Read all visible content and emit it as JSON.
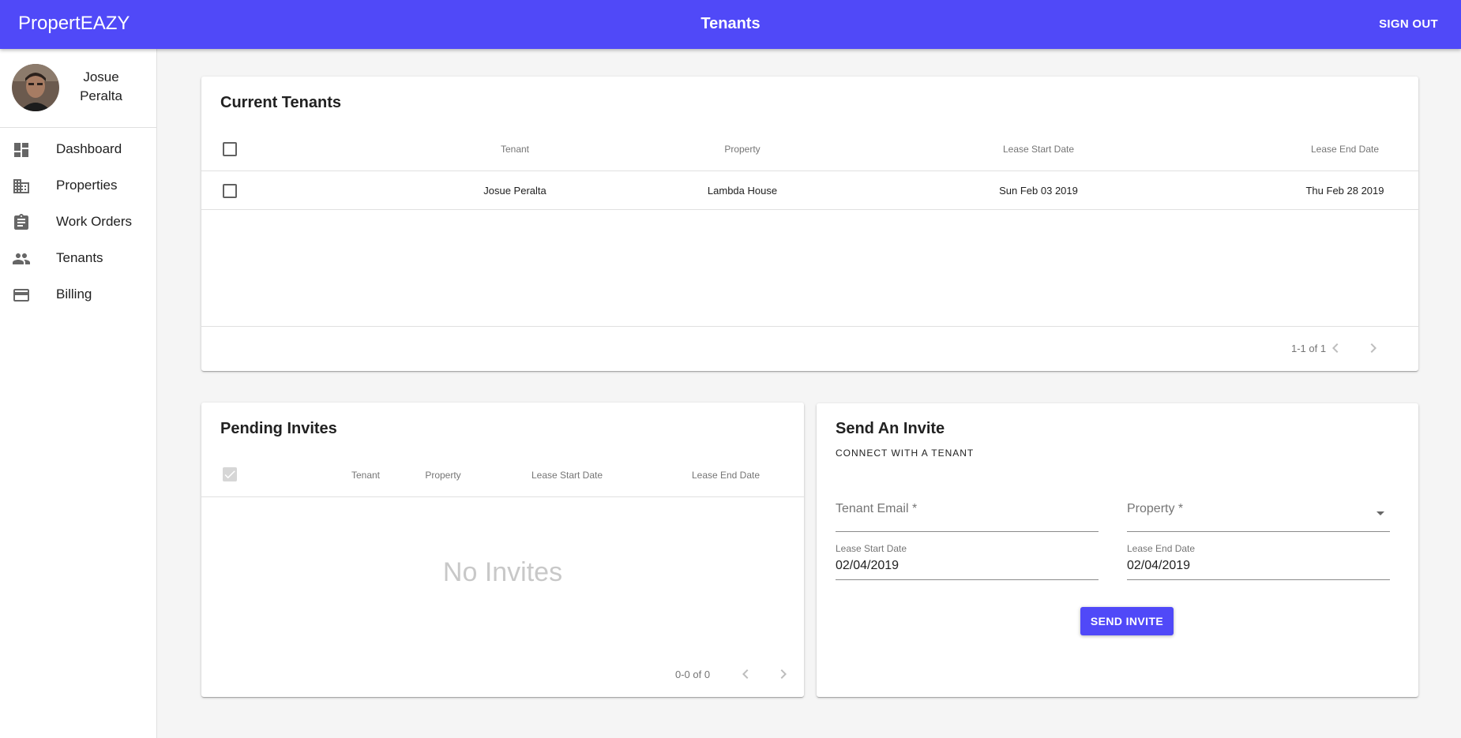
{
  "app": {
    "brand": "PropertEAZY",
    "page_title": "Tenants",
    "sign_out": "SIGN OUT"
  },
  "user": {
    "first_name": "Josue",
    "last_name": "Peralta"
  },
  "sidebar": {
    "items": [
      {
        "label": "Dashboard",
        "icon": "dashboard-icon"
      },
      {
        "label": "Properties",
        "icon": "business-icon"
      },
      {
        "label": "Work Orders",
        "icon": "assignment-icon"
      },
      {
        "label": "Tenants",
        "icon": "people-icon"
      },
      {
        "label": "Billing",
        "icon": "credit-card-icon"
      }
    ]
  },
  "current_tenants": {
    "title": "Current Tenants",
    "columns": [
      "Tenant",
      "Property",
      "Lease Start Date",
      "Lease End Date"
    ],
    "rows": [
      {
        "tenant": "Josue Peralta",
        "property": "Lambda House",
        "lease_start": "Sun Feb 03 2019",
        "lease_end": "Thu Feb 28 2019"
      }
    ],
    "pagination": "1-1 of 1"
  },
  "pending_invites": {
    "title": "Pending Invites",
    "columns": [
      "Tenant",
      "Property",
      "Lease Start Date",
      "Lease End Date"
    ],
    "empty_message": "No Invites",
    "pagination": "0-0 of 0"
  },
  "send_invite": {
    "title": "Send An Invite",
    "subtitle": "CONNECT WITH A TENANT",
    "email_label": "Tenant Email *",
    "property_label": "Property *",
    "lease_start_label": "Lease Start Date",
    "lease_start_value": "02/04/2019",
    "lease_end_label": "Lease End Date",
    "lease_end_value": "02/04/2019",
    "button": "SEND INVITE"
  },
  "colors": {
    "primary": "#5049f8",
    "background": "#f5f5f5"
  }
}
